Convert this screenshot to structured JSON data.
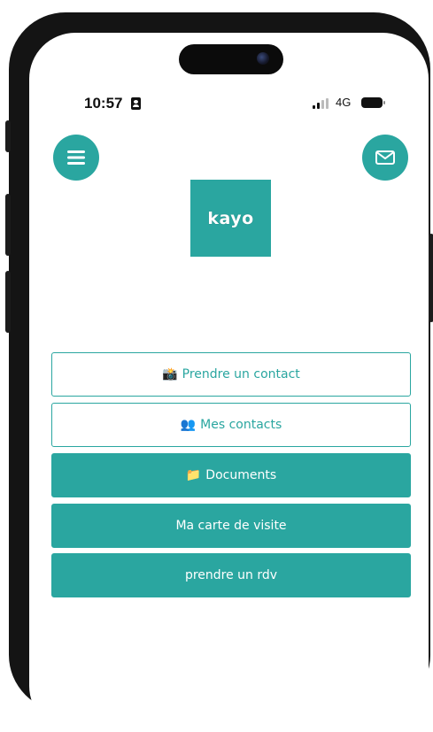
{
  "status_bar": {
    "time": "10:57",
    "network": "4G"
  },
  "header": {
    "menu_icon": "hamburger-menu-icon",
    "mail_icon": "envelope-icon"
  },
  "logo": {
    "text": "kayo"
  },
  "menu": {
    "items": [
      {
        "emoji": "📸",
        "label": "Prendre un contact",
        "style": "outline"
      },
      {
        "emoji": "👥",
        "label": "Mes contacts",
        "style": "outline"
      },
      {
        "emoji": "📁",
        "label": "Documents",
        "style": "filled"
      },
      {
        "emoji": "",
        "label": "Ma carte de visite",
        "style": "filled"
      },
      {
        "emoji": "",
        "label": "prendre un rdv",
        "style": "filled"
      }
    ]
  },
  "colors": {
    "accent": "#2aa6a0",
    "frame": "#141414"
  }
}
